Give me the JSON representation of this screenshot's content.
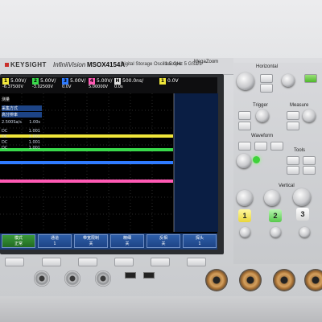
{
  "brand": "KEYSIGHT",
  "model_name": "InfiniiVision",
  "model_number": "MSOX4154A",
  "subtitle": "Digital Storage Oscilloscope",
  "specs": "1.5 GHz  5 GSa/s",
  "badge": "MegaZoom",
  "channels": [
    {
      "num": "1",
      "scale": "5.00V/",
      "offset": "-6.37500V",
      "color": "#f0e63a"
    },
    {
      "num": "2",
      "scale": "5.00V/",
      "offset": "-3.02500V",
      "color": "#38d84a"
    },
    {
      "num": "3",
      "scale": "5.00V/",
      "offset": "0.0V",
      "color": "#2f7bff"
    },
    {
      "num": "4",
      "scale": "5.00V/",
      "offset": "5.00000V",
      "color": "#ff5ab4"
    }
  ],
  "timebase": {
    "scale": "500.0ns/",
    "delay": "0.0s"
  },
  "trigger": {
    "level": "0.0V",
    "channel": "1"
  },
  "panel": {
    "title": "测量",
    "mode_line1": "采集方式",
    "mode_line2": "高分辨率",
    "rate": "2.500Sa/s",
    "rate_right": "1.00s",
    "rows": [
      {
        "label": "DC",
        "value": "1.001"
      },
      {
        "label": "DC",
        "value": "1.001"
      },
      {
        "label": "DC",
        "value": "1.001"
      },
      {
        "label": "DC",
        "value": "1.001"
      }
    ]
  },
  "softkeys": [
    {
      "top": "模式",
      "bottom": "正常"
    },
    {
      "top": "通道",
      "bottom": "1"
    },
    {
      "top": "带宽限制",
      "bottom": "关"
    },
    {
      "top": "精细",
      "bottom": "关"
    },
    {
      "top": "反相",
      "bottom": "关"
    },
    {
      "top": "探头",
      "bottom": "1"
    }
  ],
  "controls": {
    "horizontal_label": "Horizontal",
    "trigger_label": "Trigger",
    "measure_label": "Measure",
    "waveform_label": "Waveform",
    "tools_label": "Tools",
    "vertical_label": "Vertical",
    "ch_buttons": [
      "1",
      "2",
      "3"
    ]
  }
}
